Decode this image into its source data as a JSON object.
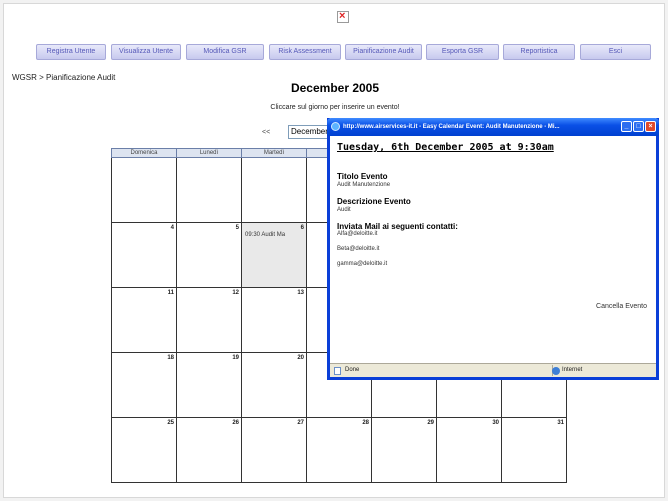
{
  "header": {
    "broken_image_icon": "broken-image-icon"
  },
  "menu": [
    {
      "label": "Registra Utente"
    },
    {
      "label": "Visualizza Utente"
    },
    {
      "label": "Modifica GSR"
    },
    {
      "label": "Risk Assessment"
    },
    {
      "label": "Pianificazione Audit"
    },
    {
      "label": "Esporta GSR"
    },
    {
      "label": "Reportistica"
    },
    {
      "label": "Esci"
    }
  ],
  "breadcrumb": "WGSR > Pianificazione Audit",
  "calendar": {
    "title": "December 2005",
    "instruction": "Cliccare sul giorno per inserire un evento!",
    "prev_label": "<<",
    "month_select_value": "December",
    "weekdays": [
      "Domenica",
      "Lunedì",
      "Martedì",
      "Me",
      "",
      "",
      ""
    ],
    "rows": [
      [
        "",
        "",
        "",
        "",
        "",
        "",
        ""
      ],
      [
        "4",
        "5",
        "6",
        "",
        "",
        "",
        ""
      ],
      [
        "11",
        "12",
        "13",
        "",
        "",
        "",
        ""
      ],
      [
        "18",
        "19",
        "20",
        "",
        "",
        "",
        ""
      ],
      [
        "25",
        "26",
        "27",
        "28",
        "29",
        "30",
        "31"
      ]
    ],
    "event": {
      "day": "6",
      "text": "09:30 Audit Ma"
    }
  },
  "popup": {
    "window_title": "http://www.airservices-it.it - Easy Calendar Event: Audit Manutenzione - Mi...",
    "heading": "Tuesday, 6th December 2005 at 9:30am",
    "title_label": "Titolo Evento",
    "title_value": "Audit Manutenzione",
    "description_label": "Descrizione Evento",
    "description_value": "Audit",
    "mail_label": "Inviata Mail ai seguenti contatti:",
    "contacts": [
      "Alfa@deloitte.it",
      "Beta@deloitte.it",
      "gamma@deloitte.it"
    ],
    "delete_label": "Cancella Evento",
    "status_left": "Done",
    "status_zone": "Internet"
  },
  "colors": {
    "menu_bg": "#c7c9ee",
    "menu_text": "#5558b8",
    "titlebar_blue": "#0a50e6",
    "today_cell": "#e9e9e9"
  }
}
